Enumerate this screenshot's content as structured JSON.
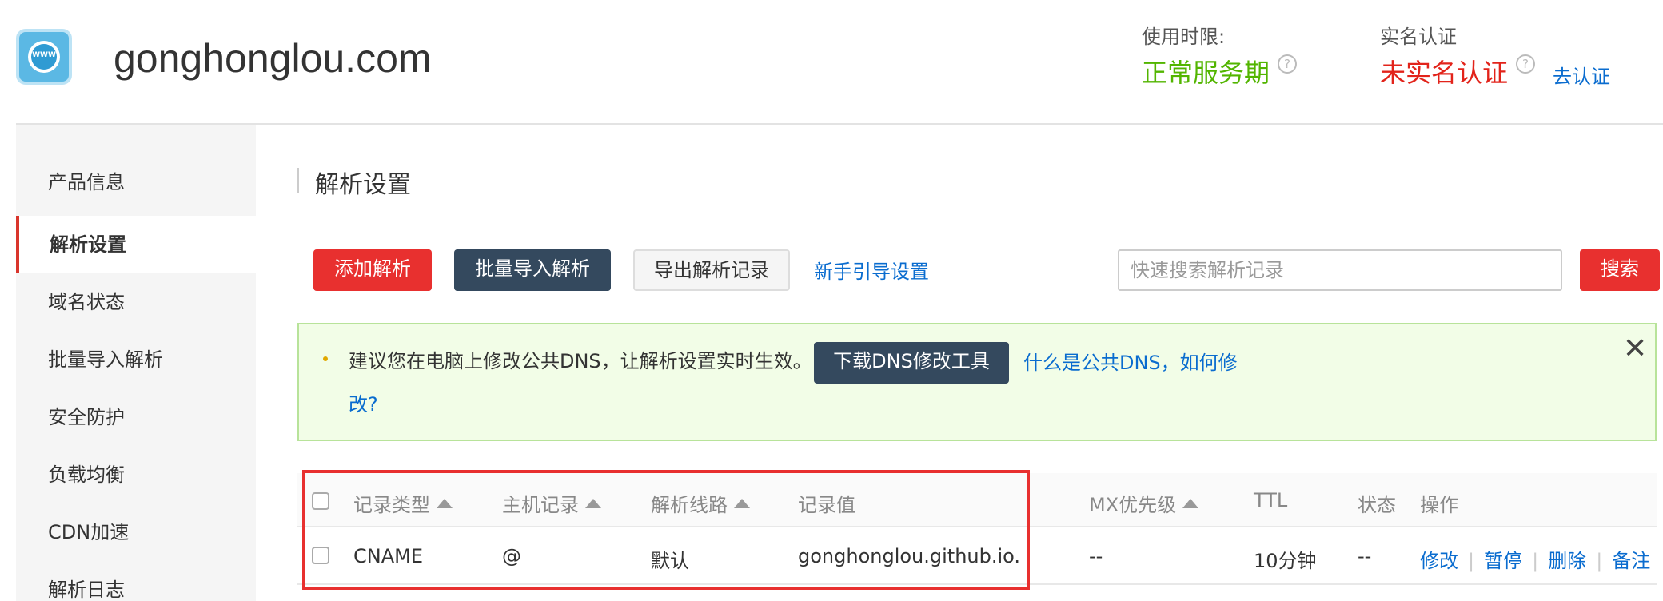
{
  "header": {
    "domain": "gonghonglou.com",
    "service": {
      "label": "使用时限:",
      "value": "正常服务期",
      "value_color": "#52b500"
    },
    "auth": {
      "label": "实名认证",
      "value": "未实名认证",
      "value_color": "#e2231a",
      "link": "去认证"
    },
    "help_icon": "?",
    "logo_text": "WWW"
  },
  "sidebar": {
    "items": [
      {
        "label": "产品信息"
      },
      {
        "label": "解析设置",
        "active": true
      },
      {
        "label": "域名状态"
      },
      {
        "label": "批量导入解析"
      },
      {
        "label": "安全防护"
      },
      {
        "label": "负载均衡"
      },
      {
        "label": "CDN加速"
      },
      {
        "label": "解析日志"
      }
    ]
  },
  "main": {
    "title": "解析设置",
    "toolbar": {
      "add": "添加解析",
      "batch_import": "批量导入解析",
      "export": "导出解析记录",
      "guide": "新手引导设置",
      "search_placeholder": "快速搜索解析记录",
      "search": "搜索"
    },
    "notice": {
      "text": "建议您在电脑上修改公共DNS，让解析设置实时生效。",
      "button": "下载DNS修改工具",
      "link_line1": "什么是公共DNS，如何修",
      "link_line2": "改?",
      "close": "✕"
    },
    "table": {
      "columns": {
        "type": "记录类型",
        "host": "主机记录",
        "line": "解析线路",
        "value": "记录值",
        "mx": "MX优先级",
        "ttl": "TTL",
        "status": "状态",
        "actions": "操作"
      },
      "rows": [
        {
          "type": "CNAME",
          "host": "@",
          "line": "默认",
          "value": "gonghonglou.github.io.",
          "mx": "--",
          "ttl": "10分钟",
          "status": "--",
          "actions": {
            "edit": "修改",
            "pause": "暂停",
            "delete": "删除",
            "note": "备注"
          }
        }
      ]
    }
  },
  "colors": {
    "brand_red": "#e8302f",
    "dark_button": "#34495e",
    "link_blue": "#0a6ccf",
    "notice_bg": "#f2fde7"
  }
}
